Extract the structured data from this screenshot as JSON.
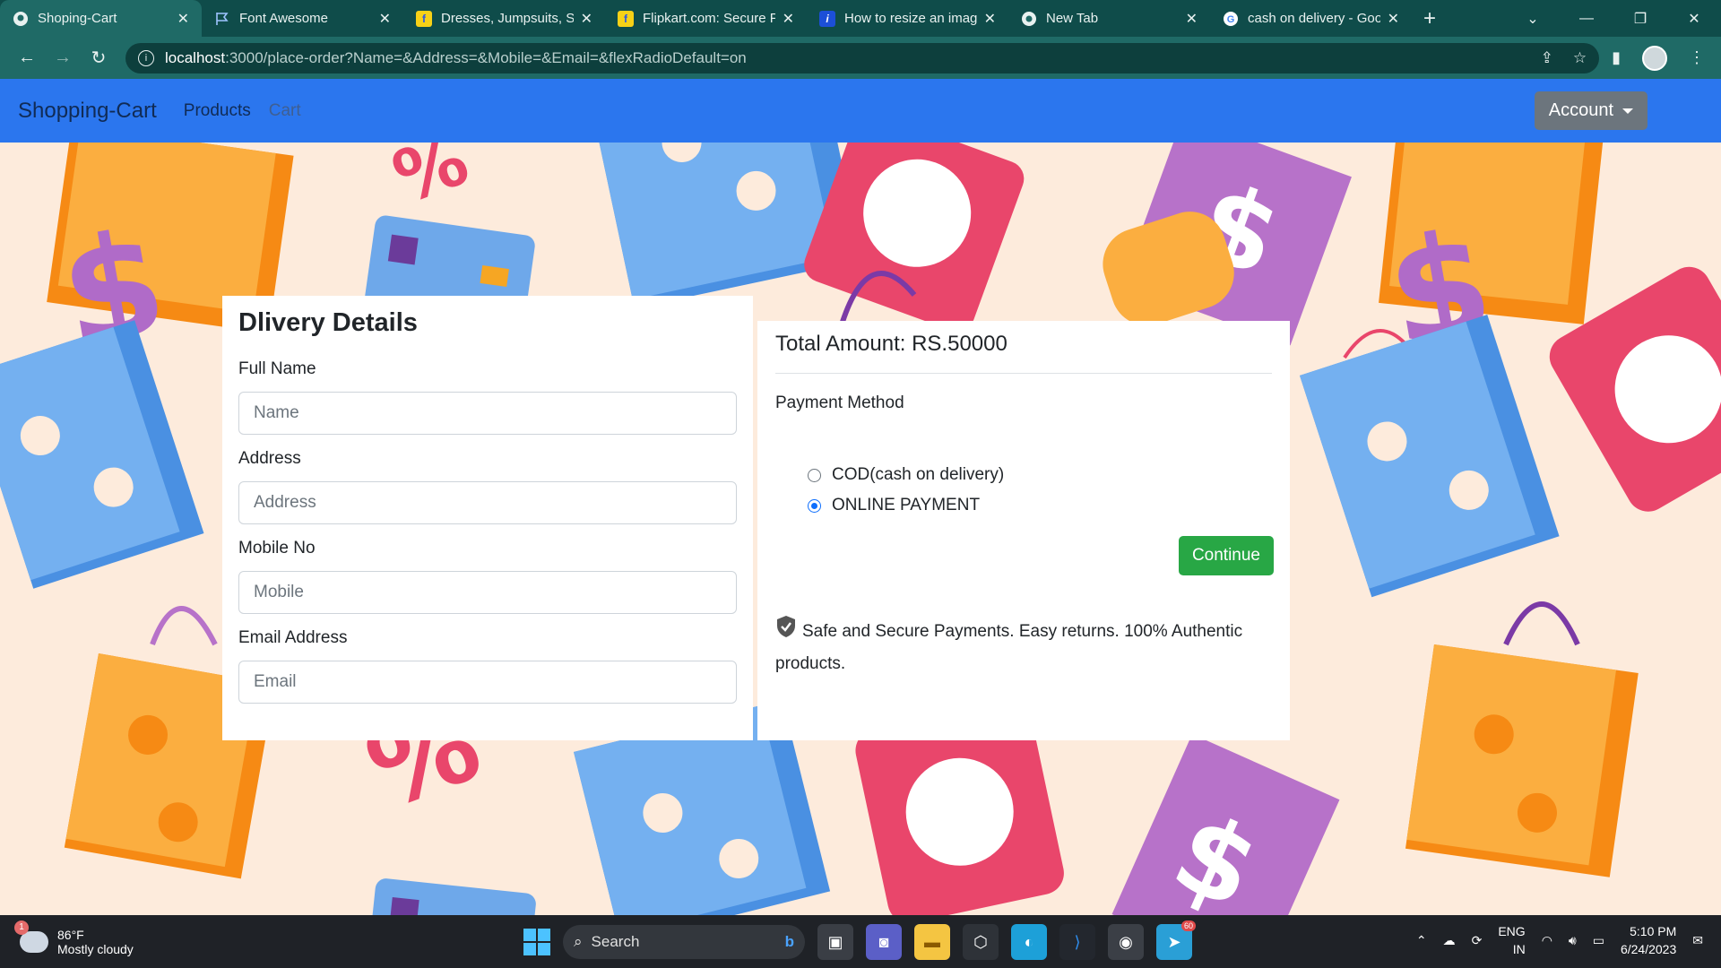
{
  "browser": {
    "tabs": [
      {
        "title": "Shoping-Cart",
        "active": true,
        "icon": "github-icon"
      },
      {
        "title": "Font Awesome",
        "active": false,
        "icon": "flag-icon"
      },
      {
        "title": "Dresses, Jumpsuits, Sk",
        "active": false,
        "icon": "flipkart-icon"
      },
      {
        "title": "Flipkart.com: Secure P",
        "active": false,
        "icon": "flipkart-icon"
      },
      {
        "title": "How to resize an imag",
        "active": false,
        "icon": "info-icon"
      },
      {
        "title": "New Tab",
        "active": false,
        "icon": "chrome-icon"
      },
      {
        "title": "cash on delivery - Goo",
        "active": false,
        "icon": "google-icon"
      }
    ],
    "url_host": "localhost",
    "url_rest": ":3000/place-order?Name=&Address=&Mobile=&Email=&flexRadioDefault=on"
  },
  "navbar": {
    "brand": "Shopping-Cart",
    "links": [
      "Products",
      "Cart"
    ],
    "account": "Account"
  },
  "delivery": {
    "title": "Dlivery Details",
    "fields": [
      {
        "label": "Full Name",
        "placeholder": "Name",
        "value": ""
      },
      {
        "label": "Address",
        "placeholder": "Address",
        "value": ""
      },
      {
        "label": "Mobile No",
        "placeholder": "Mobile",
        "value": ""
      },
      {
        "label": "Email Address",
        "placeholder": "Email",
        "value": ""
      }
    ]
  },
  "summary": {
    "total": "Total Amount: RS.50000",
    "payment_method_label": "Payment Method",
    "options": [
      {
        "label": "COD(cash on delivery)",
        "checked": false
      },
      {
        "label": "ONLINE PAYMENT",
        "checked": true
      }
    ],
    "continue_label": "Continue",
    "secure_text": "Safe and Secure Payments. Easy returns. 100% Authentic products."
  },
  "taskbar": {
    "temperature": "86°F",
    "weather": "Mostly cloudy",
    "weather_badge": "1",
    "search_label": "Search",
    "telegram_badge": "60",
    "lang_top": "ENG",
    "lang_bottom": "IN",
    "time": "5:10 PM",
    "date": "6/24/2023"
  },
  "colors": {
    "navbar": "#2b76ee",
    "continue": "#28a745",
    "radio_checked": "#0d6efd",
    "background": "#fdebdc"
  }
}
